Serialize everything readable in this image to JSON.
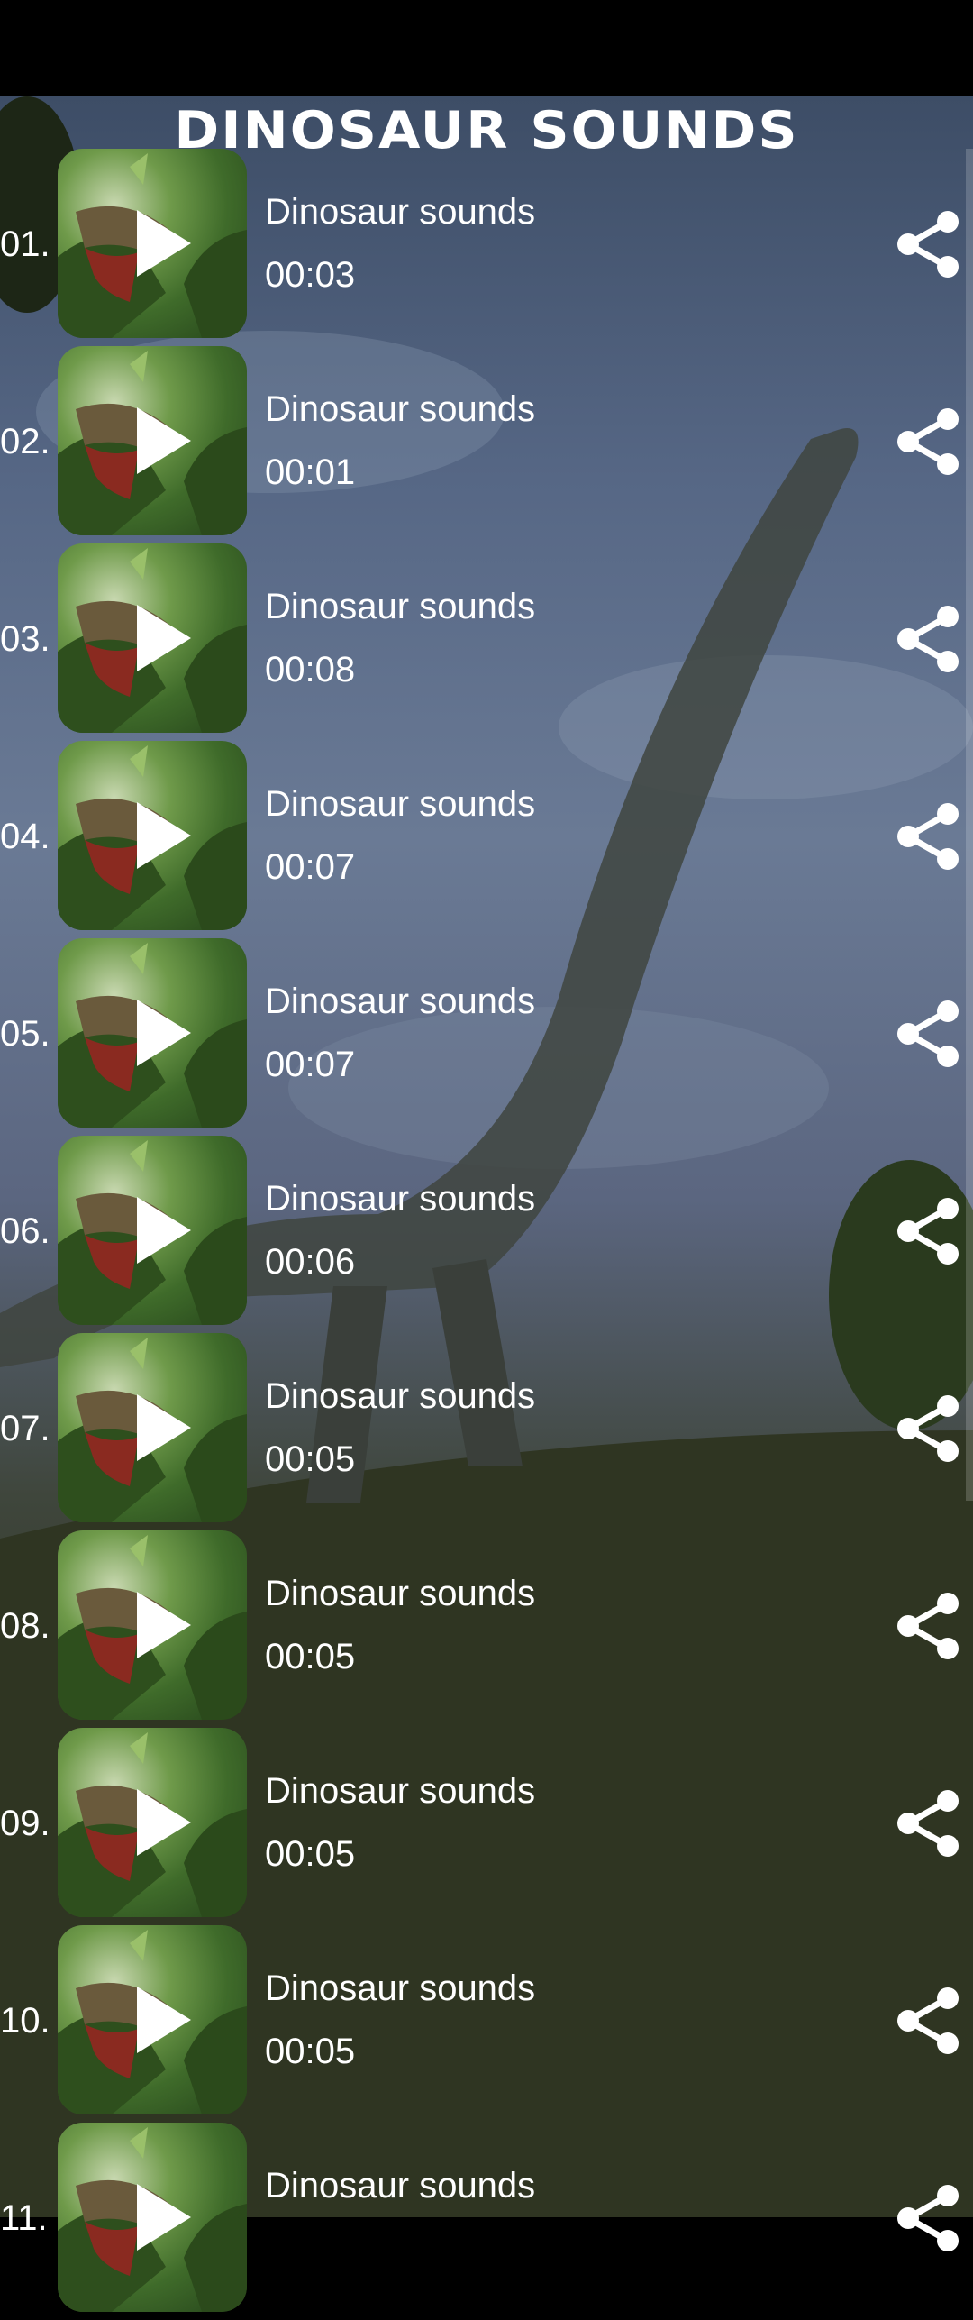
{
  "app": {
    "title": "DINOSAUR SOUNDS"
  },
  "sounds": [
    {
      "number": "01.",
      "name": "Dinosaur sounds",
      "duration": "00:03"
    },
    {
      "number": "02.",
      "name": "Dinosaur sounds",
      "duration": "00:01"
    },
    {
      "number": "03.",
      "name": "Dinosaur sounds",
      "duration": "00:08"
    },
    {
      "number": "04.",
      "name": "Dinosaur sounds",
      "duration": "00:07"
    },
    {
      "number": "05.",
      "name": "Dinosaur sounds",
      "duration": "00:07"
    },
    {
      "number": "06.",
      "name": "Dinosaur sounds",
      "duration": "00:06"
    },
    {
      "number": "07.",
      "name": "Dinosaur sounds",
      "duration": "00:05"
    },
    {
      "number": "08.",
      "name": "Dinosaur sounds",
      "duration": "00:05"
    },
    {
      "number": "09.",
      "name": "Dinosaur sounds",
      "duration": "00:05"
    },
    {
      "number": "10.",
      "name": "Dinosaur sounds",
      "duration": "00:05"
    },
    {
      "number": "11.",
      "name": "Dinosaur sounds",
      "duration": ""
    }
  ],
  "icons": {
    "play": "play-icon",
    "share": "share-icon"
  }
}
